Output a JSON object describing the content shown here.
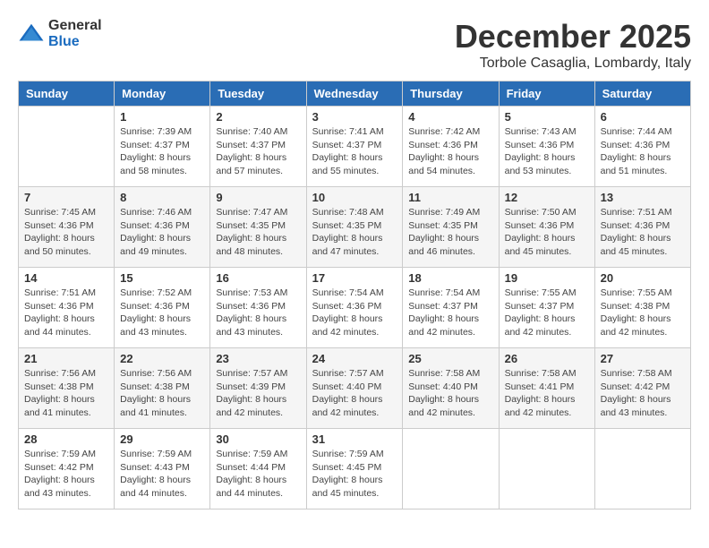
{
  "logo": {
    "general": "General",
    "blue": "Blue"
  },
  "header": {
    "month": "December 2025",
    "location": "Torbole Casaglia, Lombardy, Italy"
  },
  "weekdays": [
    "Sunday",
    "Monday",
    "Tuesday",
    "Wednesday",
    "Thursday",
    "Friday",
    "Saturday"
  ],
  "weeks": [
    [
      {
        "day": "",
        "info": ""
      },
      {
        "day": "1",
        "info": "Sunrise: 7:39 AM\nSunset: 4:37 PM\nDaylight: 8 hours\nand 58 minutes."
      },
      {
        "day": "2",
        "info": "Sunrise: 7:40 AM\nSunset: 4:37 PM\nDaylight: 8 hours\nand 57 minutes."
      },
      {
        "day": "3",
        "info": "Sunrise: 7:41 AM\nSunset: 4:37 PM\nDaylight: 8 hours\nand 55 minutes."
      },
      {
        "day": "4",
        "info": "Sunrise: 7:42 AM\nSunset: 4:36 PM\nDaylight: 8 hours\nand 54 minutes."
      },
      {
        "day": "5",
        "info": "Sunrise: 7:43 AM\nSunset: 4:36 PM\nDaylight: 8 hours\nand 53 minutes."
      },
      {
        "day": "6",
        "info": "Sunrise: 7:44 AM\nSunset: 4:36 PM\nDaylight: 8 hours\nand 51 minutes."
      }
    ],
    [
      {
        "day": "7",
        "info": "Sunrise: 7:45 AM\nSunset: 4:36 PM\nDaylight: 8 hours\nand 50 minutes."
      },
      {
        "day": "8",
        "info": "Sunrise: 7:46 AM\nSunset: 4:36 PM\nDaylight: 8 hours\nand 49 minutes."
      },
      {
        "day": "9",
        "info": "Sunrise: 7:47 AM\nSunset: 4:35 PM\nDaylight: 8 hours\nand 48 minutes."
      },
      {
        "day": "10",
        "info": "Sunrise: 7:48 AM\nSunset: 4:35 PM\nDaylight: 8 hours\nand 47 minutes."
      },
      {
        "day": "11",
        "info": "Sunrise: 7:49 AM\nSunset: 4:35 PM\nDaylight: 8 hours\nand 46 minutes."
      },
      {
        "day": "12",
        "info": "Sunrise: 7:50 AM\nSunset: 4:36 PM\nDaylight: 8 hours\nand 45 minutes."
      },
      {
        "day": "13",
        "info": "Sunrise: 7:51 AM\nSunset: 4:36 PM\nDaylight: 8 hours\nand 45 minutes."
      }
    ],
    [
      {
        "day": "14",
        "info": "Sunrise: 7:51 AM\nSunset: 4:36 PM\nDaylight: 8 hours\nand 44 minutes."
      },
      {
        "day": "15",
        "info": "Sunrise: 7:52 AM\nSunset: 4:36 PM\nDaylight: 8 hours\nand 43 minutes."
      },
      {
        "day": "16",
        "info": "Sunrise: 7:53 AM\nSunset: 4:36 PM\nDaylight: 8 hours\nand 43 minutes."
      },
      {
        "day": "17",
        "info": "Sunrise: 7:54 AM\nSunset: 4:36 PM\nDaylight: 8 hours\nand 42 minutes."
      },
      {
        "day": "18",
        "info": "Sunrise: 7:54 AM\nSunset: 4:37 PM\nDaylight: 8 hours\nand 42 minutes."
      },
      {
        "day": "19",
        "info": "Sunrise: 7:55 AM\nSunset: 4:37 PM\nDaylight: 8 hours\nand 42 minutes."
      },
      {
        "day": "20",
        "info": "Sunrise: 7:55 AM\nSunset: 4:38 PM\nDaylight: 8 hours\nand 42 minutes."
      }
    ],
    [
      {
        "day": "21",
        "info": "Sunrise: 7:56 AM\nSunset: 4:38 PM\nDaylight: 8 hours\nand 41 minutes."
      },
      {
        "day": "22",
        "info": "Sunrise: 7:56 AM\nSunset: 4:38 PM\nDaylight: 8 hours\nand 41 minutes."
      },
      {
        "day": "23",
        "info": "Sunrise: 7:57 AM\nSunset: 4:39 PM\nDaylight: 8 hours\nand 42 minutes."
      },
      {
        "day": "24",
        "info": "Sunrise: 7:57 AM\nSunset: 4:40 PM\nDaylight: 8 hours\nand 42 minutes."
      },
      {
        "day": "25",
        "info": "Sunrise: 7:58 AM\nSunset: 4:40 PM\nDaylight: 8 hours\nand 42 minutes."
      },
      {
        "day": "26",
        "info": "Sunrise: 7:58 AM\nSunset: 4:41 PM\nDaylight: 8 hours\nand 42 minutes."
      },
      {
        "day": "27",
        "info": "Sunrise: 7:58 AM\nSunset: 4:42 PM\nDaylight: 8 hours\nand 43 minutes."
      }
    ],
    [
      {
        "day": "28",
        "info": "Sunrise: 7:59 AM\nSunset: 4:42 PM\nDaylight: 8 hours\nand 43 minutes."
      },
      {
        "day": "29",
        "info": "Sunrise: 7:59 AM\nSunset: 4:43 PM\nDaylight: 8 hours\nand 44 minutes."
      },
      {
        "day": "30",
        "info": "Sunrise: 7:59 AM\nSunset: 4:44 PM\nDaylight: 8 hours\nand 44 minutes."
      },
      {
        "day": "31",
        "info": "Sunrise: 7:59 AM\nSunset: 4:45 PM\nDaylight: 8 hours\nand 45 minutes."
      },
      {
        "day": "",
        "info": ""
      },
      {
        "day": "",
        "info": ""
      },
      {
        "day": "",
        "info": ""
      }
    ]
  ]
}
